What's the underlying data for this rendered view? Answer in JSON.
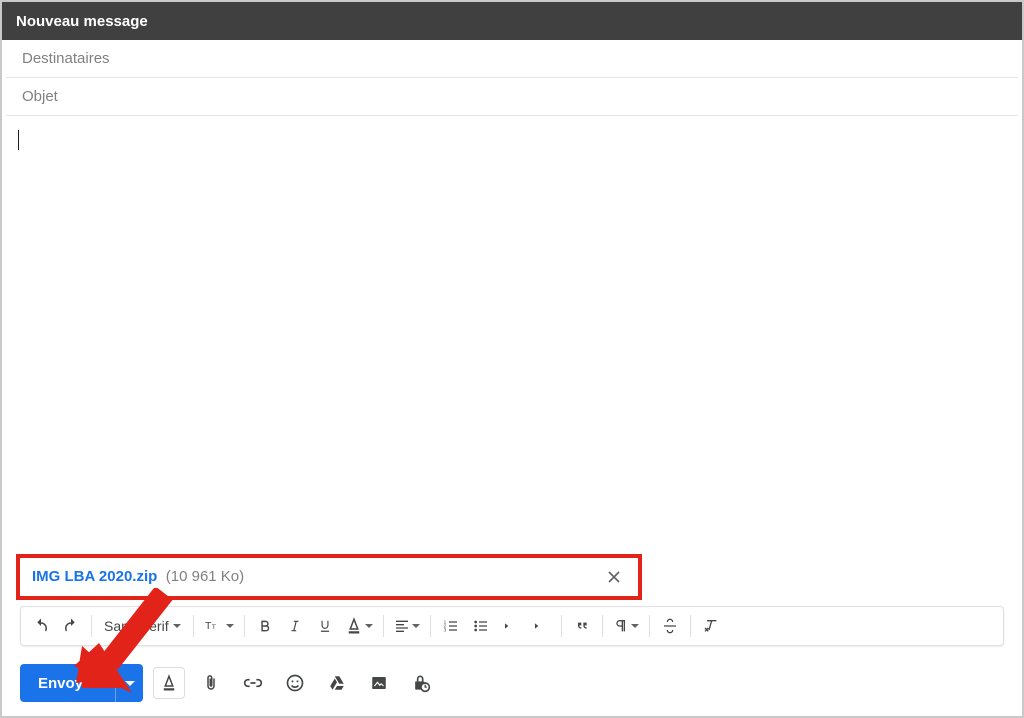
{
  "header": {
    "title": "Nouveau message"
  },
  "fields": {
    "recipients_placeholder": "Destinataires",
    "recipients_value": "",
    "subject_placeholder": "Objet",
    "subject_value": "",
    "body_value": ""
  },
  "attachment": {
    "filename": "IMG LBA 2020.zip",
    "size_label": "(10 961 Ko)"
  },
  "format_toolbar": {
    "font_name": "Sans Serif"
  },
  "send": {
    "label": "Envoyer"
  },
  "colors": {
    "accent": "#1a73e8",
    "highlight": "#e2231a"
  }
}
